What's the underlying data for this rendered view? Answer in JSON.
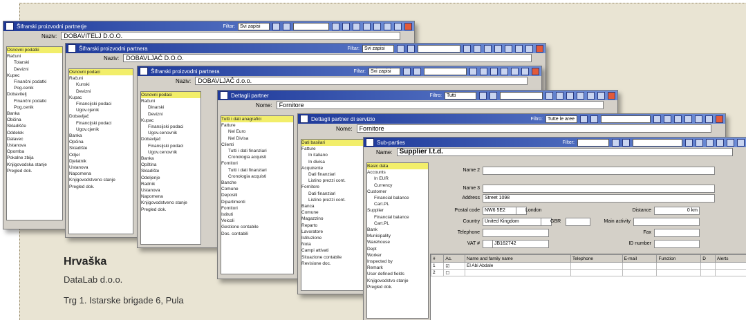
{
  "windows": [
    {
      "title": "Šifrarski proizvodni partnerje",
      "filter_label": "Filtar:",
      "filter_value": "Svi zapisi",
      "name_label": "Naziv:",
      "name_value": "DOBAVITELJ D.O.O.",
      "tree": [
        "Osnovni podatki",
        "Računi",
        "Tolarski",
        "Devizni",
        "Kupec",
        "Finančni podatki",
        "Pog.cenik",
        "Dobavitelj",
        "Finančni podatki",
        "Pog.cenik",
        "Banka",
        "Občina",
        "Skladišče",
        "Oddelek",
        "Dalavec",
        "Ustanova",
        "Opomba",
        "Pokalne zbija",
        "Knjigovodska stanje",
        "Pregled dok."
      ]
    },
    {
      "title": "Šifrarski proizvodni partnera",
      "filter_label": "Filtar:",
      "filter_value": "Svi zapisi",
      "name_label": "Naziv:",
      "name_value": "DOBAVLJAČ D.O.O.",
      "tree": [
        "Osnovni podaci",
        "Računi",
        "Kunski",
        "Devizni",
        "Kupac",
        "Financijski podaci",
        "Ugov.cjenik",
        "Dobavljač",
        "Financijski podaci",
        "Ugov.cjenik",
        "Banka",
        "Općina",
        "Skladište",
        "Odjel",
        "Djelatnik",
        "Ustanova",
        "Napomena",
        "Knjigovodstveno stanje",
        "Pregled dok."
      ]
    },
    {
      "title": "Šifrarski proizvodni partnera",
      "filter_label": "Filtar:",
      "filter_value": "Svi zapisi",
      "name_label": "Naziv:",
      "name_value": "DOBAVLJAČ d.o.o.",
      "tree": [
        "Osnovni podaci",
        "Računi",
        "Dinarski",
        "Devizni",
        "Kupac",
        "Finansijski podaci",
        "Ugov.cenovnik",
        "Dobavljač",
        "Finansijski podaci",
        "Ugov.cenovnik",
        "Banka",
        "Opština",
        "Skladište",
        "Odeljenje",
        "Radnik",
        "Ustanova",
        "Napomena",
        "Knjigovodstveno stanje",
        "Pregled dok."
      ]
    },
    {
      "title": "Dettagli partner",
      "filter_label": "Filtro:",
      "filter_value": "Tutti",
      "name_label": "Nome:",
      "name_value": "Fornitore",
      "tree": [
        "Tutti i dati anagrafici",
        "Fatture",
        "Nel Euro",
        "Nel Divisa",
        "Clienti",
        "Tutti i dati finanziari",
        "Cronologia acquisti",
        "Fornitori",
        "Tutti i dati finanziari",
        "Cronologia acquisti",
        "Banche",
        "Comune",
        "Depositi",
        "Dipartimenti",
        "Fornitori",
        "Istituti",
        "Veicoli",
        "Gestione contabile",
        "Doc. contabili"
      ]
    },
    {
      "title": "Dettagli partner di servizio",
      "filter_label": "Filtro:",
      "filter_value": "Tutte le aree",
      "name_label": "Nome:",
      "name_value": "Fornitore",
      "tree": [
        "Dati basilari",
        "Fatture",
        "In italiano",
        "In divisa",
        "Acquirente",
        "Dati finanziari",
        "Listino prezzi cont.",
        "Fornitore",
        "Dati finanziari",
        "Listino prezzi cont.",
        "Banca",
        "Comune",
        "Magazzino",
        "Reparto",
        "Lavoratore",
        "Istituzione",
        "Nota",
        "Campi attivati",
        "Situazione contabile",
        "Revisione doc."
      ]
    }
  ],
  "front": {
    "title": "Sub-parties",
    "filter_label": "Filter:",
    "name_label": "Name:",
    "name_value": "Supplier l.t.d.",
    "tree": [
      "Basic data",
      "Accounts",
      "In EUR",
      "Currency",
      "Customer",
      "Financial balance",
      "Cart.PL",
      "Supplier",
      "Financial balance",
      "Cart.PL",
      "Bank",
      "Municipality",
      "Warehouse",
      "Dept",
      "Worker",
      "Inspected by",
      "Remark",
      "User defined fields",
      "Knjigovodstvo stanje",
      "Pregled dok."
    ],
    "form": {
      "name2_label": "Name 2",
      "name3_label": "Name 3",
      "address_label": "Address",
      "address_value": "Street 1098",
      "postal_label": "Postal code",
      "postal_value": "NW6 5E2",
      "city_value": "London",
      "distance_label": "Distance",
      "distance_value": "0 km",
      "country_label": "Country",
      "country_value": "United Kingdom",
      "country_code": "GBR",
      "main_activity_label": "Main activity",
      "telephone_label": "Telephone",
      "fax_label": "Fax",
      "vat_label": "VAT #",
      "vat_value": "JB162742",
      "id_label": "ID number"
    },
    "table": {
      "headers": [
        "#",
        "Ac.",
        "Name and family name",
        "Telephone",
        "E-mail",
        "Function",
        "D",
        "Alerts"
      ],
      "rows": [
        [
          "1",
          "",
          "El Abi Abdale",
          "",
          "",
          "",
          "",
          ""
        ],
        [
          "2",
          "",
          "",
          "",
          "",
          "",
          "",
          ""
        ]
      ]
    }
  },
  "caption": {
    "country": "Hrvaška",
    "company": "DataLab d.o.o.",
    "address": "Trg 1. Istarske brigade 6, Pula"
  }
}
